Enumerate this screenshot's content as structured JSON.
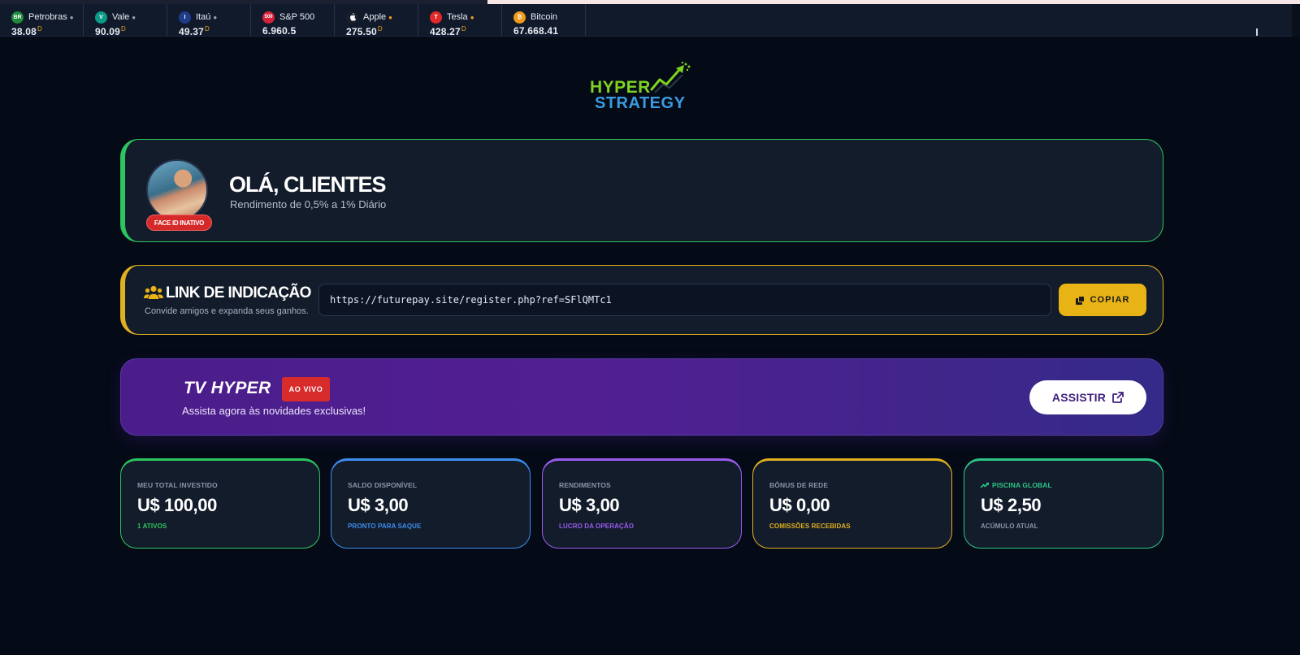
{
  "ticker": [
    {
      "name": "Petrobras",
      "price": "38.08",
      "flag": "D",
      "logo_text": "BR",
      "logo_color": "#1e8a3a",
      "dot_color": "#9aa3b5"
    },
    {
      "name": "Vale",
      "price": "90.09",
      "flag": "D",
      "logo_text": "V",
      "logo_color": "#0b9b8a",
      "dot_color": "#9aa3b5"
    },
    {
      "name": "Itaú",
      "price": "49.37",
      "flag": "D",
      "logo_text": "I",
      "logo_color": "#1f3c8a",
      "dot_color": "#9aa3b5"
    },
    {
      "name": "S&P 500",
      "price": "6.960.5",
      "flag": "",
      "logo_text": "500",
      "logo_color": "#d6223a",
      "dot_color": ""
    },
    {
      "name": "Apple",
      "price": "275.50",
      "flag": "D",
      "logo_text": "",
      "logo_color": "#1a1f2b",
      "dot_color": "#f0a020"
    },
    {
      "name": "Tesla",
      "price": "428.27",
      "flag": "D",
      "logo_text": "T",
      "logo_color": "#e02a2a",
      "dot_color": "#f0a020"
    },
    {
      "name": "Bitcoin",
      "price": "67.668.41",
      "flag": "",
      "logo_text": "₿",
      "logo_color": "#f29a1a",
      "dot_color": ""
    }
  ],
  "brand": {
    "line1": "HYPER",
    "line2": "STRATEGY"
  },
  "hello": {
    "title": "OLÁ, CLIENTES",
    "subtitle": "Rendimento de 0,5% a 1% Diário",
    "badge": "FACE ID INATIVO"
  },
  "referral": {
    "title": "LINK DE INDICAÇÃO",
    "subtitle": "Convide amigos e expanda seus ganhos.",
    "url": "https://futurepay.site/register.php?ref=SFlQMTc1",
    "copy_label": "COPIAR"
  },
  "tv": {
    "title": "TV HYPER",
    "badge": "AO VIVO",
    "subtitle": "Assista agora às novidades exclusivas!",
    "button": "ASSISTIR"
  },
  "stats": [
    {
      "label": "MEU TOTAL INVESTIDO",
      "value": "U$ 100,00",
      "note": "1 ATIVOS",
      "color": "#2cc55e",
      "icon": ""
    },
    {
      "label": "SALDO DISPONÍVEL",
      "value": "U$ 3,00",
      "note": "PRONTO PARA SAQUE",
      "color": "#3c8ef0",
      "icon": ""
    },
    {
      "label": "RENDIMENTOS",
      "value": "U$ 3,00",
      "note": "LUCRO DA OPERAÇÃO",
      "color": "#9a5cf0",
      "icon": ""
    },
    {
      "label": "BÔNUS DE REDE",
      "value": "U$ 0,00",
      "note": "COMISSÕES RECEBIDAS",
      "color": "#e0b020",
      "icon": ""
    },
    {
      "label": "PISCINA GLOBAL",
      "value": "U$ 2,50",
      "note": "ACÚMULO ATUAL",
      "color": "#2cc585",
      "icon": "trend-icon"
    }
  ]
}
